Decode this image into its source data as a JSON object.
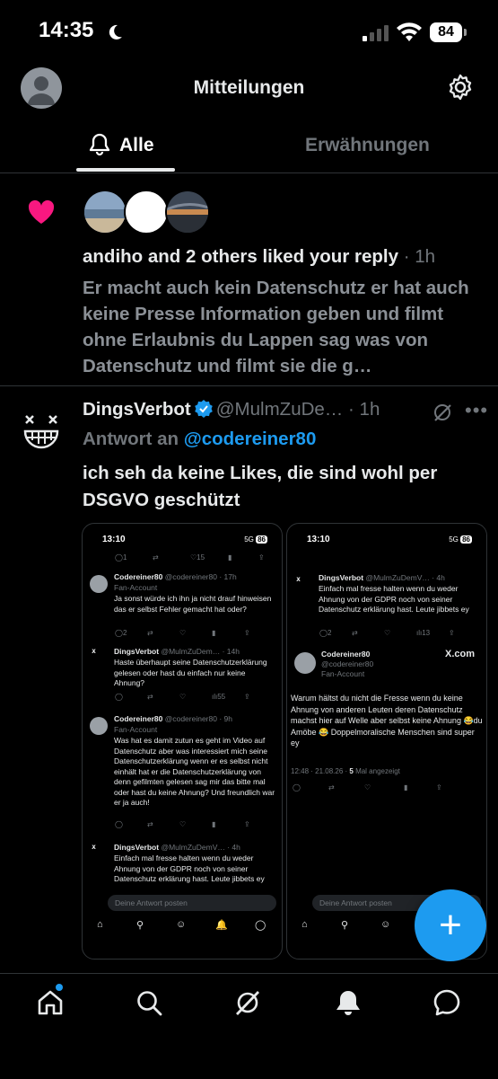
{
  "status_bar": {
    "time": "14:35",
    "battery": "84"
  },
  "header": {
    "title": "Mitteilungen"
  },
  "tabs": [
    {
      "label": "Alle"
    },
    {
      "label": "Erwähnungen"
    }
  ],
  "like_notification": {
    "title": "andiho and 2 others liked your reply",
    "time": "· 1h",
    "body": "Er macht auch kein Datenschutz er hat auch keine Presse Information geben und filmt ohne Erlaubnis du Lappen sag was von Datenschutz und filmt sie die g…"
  },
  "reply_tweet": {
    "name": "DingsVerbot",
    "handle": "@MulmZuDe…",
    "time": "· 1h",
    "reply_prefix": "Antwort an",
    "reply_to": "@codereiner80",
    "text": "ich seh da keine Likes, die sind wohl per DSGVO geschützt"
  },
  "screenshot_left": {
    "time": "13:10",
    "net": "5G",
    "battery": "86",
    "top_actions": [
      "1",
      "",
      "15",
      "",
      ""
    ],
    "tweets": [
      {
        "name": "Codereiner80",
        "handle": "@codereiner80 · 17h",
        "sub": "Fan-Account",
        "text": "Ja sonst würde ich ihn ja nicht drauf hinweisen das er selbst Fehler gemacht hat oder?",
        "actions": [
          "2",
          "",
          "",
          "",
          ""
        ]
      },
      {
        "name": "DingsVerbot",
        "handle": "@MulmZuDem… · 14h",
        "sub": "",
        "text": "Haste überhaupt seine Datenschutzerklärung gelesen oder hast du einfach nur keine Ahnung?",
        "actions": [
          "",
          "",
          "",
          "55",
          ""
        ]
      },
      {
        "name": "Codereiner80",
        "handle": "@codereiner80 · 9h",
        "sub": "Fan-Account",
        "text": "Was hat es damit zutun es geht im Video auf Datenschutz aber was interessiert mich seine Datenschutzerklärung wenn er es selbst nicht einhält hat er die Datenschutzerklärung von denn gefilmten gelesen sag mir das bitte mal oder hast du keine Ahnung? Und freundlich war er ja auch!",
        "actions": [
          "",
          "",
          "",
          "",
          ""
        ]
      },
      {
        "name": "DingsVerbot",
        "handle": "@MulmZuDemV… · 4h",
        "sub": "",
        "text": "Einfach mal fresse halten wenn du weder Ahnung von der GDPR noch von seiner Datenschutz erklärung hast. Leute jibbets ey",
        "actions": []
      }
    ],
    "compose_placeholder": "Deine Antwort posten"
  },
  "screenshot_right": {
    "time": "13:10",
    "net": "5G",
    "battery": "86",
    "tweet": {
      "name": "DingsVerbot",
      "handle": "@MulmZuDemV… · 4h",
      "text": "Einfach mal fresse halten wenn du weder Ahnung von der GDPR noch von seiner Datenschutz erklärung hast. Leute jibbets ey",
      "actions": [
        "2",
        "",
        "",
        "13",
        ""
      ]
    },
    "author": {
      "name": "Codereiner80",
      "handle": "@codereiner80",
      "sub": "Fan-Account",
      "brand": "X.com"
    },
    "main_text": "Warum hältst du nicht die Fresse wenn du keine Ahnung von anderen Leuten deren Datenschutz machst hier auf Welle aber selbst keine Ahnung 😂du Amöbe 😂 Doppelmoralische Menschen sind super ey",
    "meta": "12:48 · 21.08.26 · ",
    "views": "5",
    "views_label": " Mal angezeigt",
    "compose_placeholder": "Deine Antwort posten"
  },
  "colors": {
    "accent": "#1d9bf0",
    "like": "#f91880",
    "muted": "#71767b"
  },
  "icons": [
    "moon-icon",
    "signal-icon",
    "wifi-icon",
    "gear-icon",
    "bell-icon",
    "heart-icon",
    "verified-icon",
    "grok-icon",
    "plus-icon",
    "home-icon",
    "search-icon",
    "grok-tab-icon",
    "notifications-tab-icon",
    "messages-tab-icon"
  ]
}
